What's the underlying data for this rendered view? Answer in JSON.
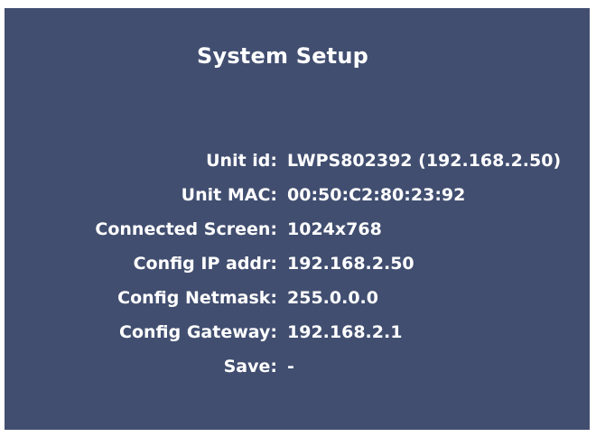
{
  "screen": {
    "title": "System Setup",
    "fields": [
      {
        "label": "Unit id:",
        "value": "LWPS802392 (192.168.2.50)"
      },
      {
        "label": "Unit MAC:",
        "value": "00:50:C2:80:23:92"
      },
      {
        "label": "Connected Screen:",
        "value": "1024x768"
      },
      {
        "label": "Config IP addr:",
        "value": "192.168.2.50"
      },
      {
        "label": "Config Netmask:",
        "value": "255.0.0.0"
      },
      {
        "label": "Config Gateway:",
        "value": "192.168.2.1"
      },
      {
        "label": "Save:",
        "value": "-"
      }
    ]
  },
  "colors": {
    "panel_background": "#414e70",
    "text": "#ffffff",
    "page_background": "#ffffff"
  }
}
